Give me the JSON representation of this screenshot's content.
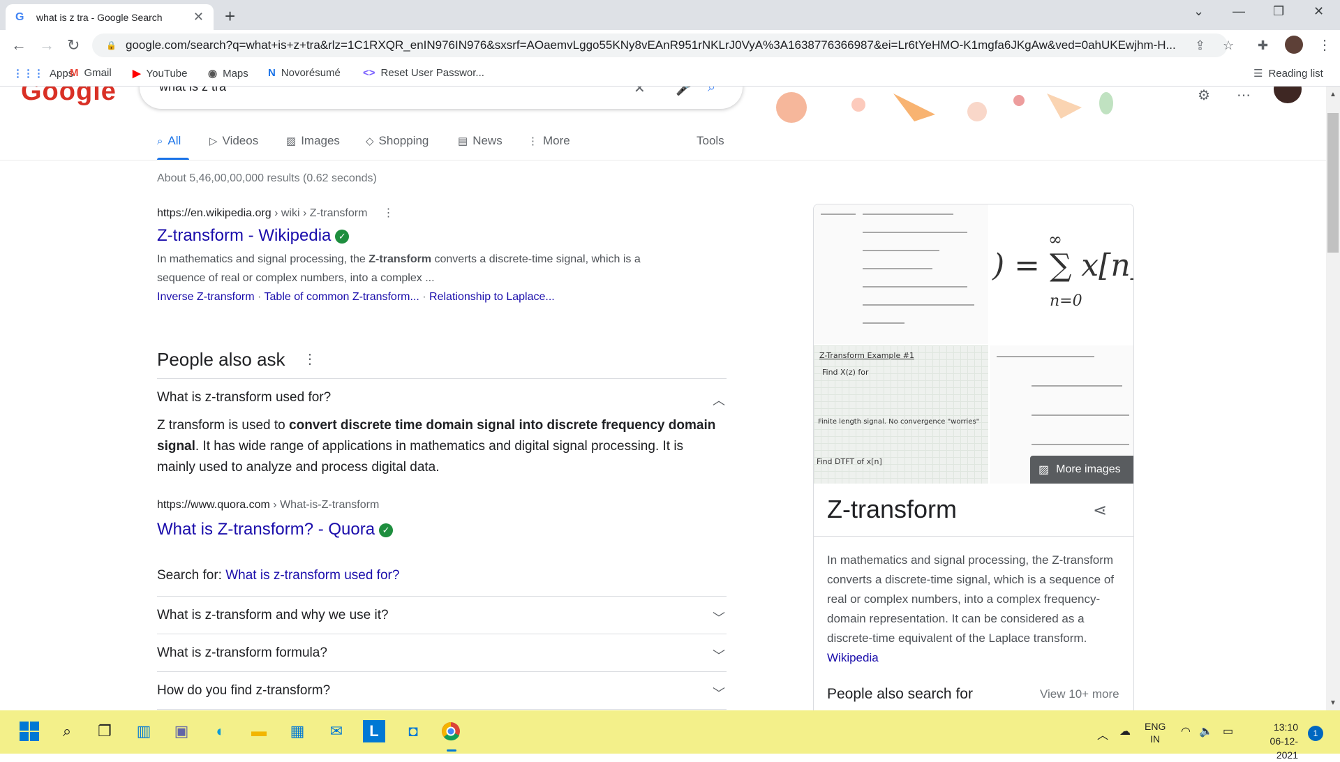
{
  "browser": {
    "tab_title": "what is z tra - Google Search",
    "url": "google.com/search?q=what+is+z+tra&rlz=1C1RXQR_enIN976IN976&sxsrf=AOaemvLggo55KNy8vEAnR951rNKLrJ0VyA%3A1638776366987&ei=Lr6tYeHMO-K1mgfa6JKgAw&ved=0ahUKEwjhm-H...",
    "bookmarks": [
      "Apps",
      "Gmail",
      "YouTube",
      "Maps",
      "Novorésumé",
      "Reset User Passwor..."
    ],
    "reading_list": "Reading list"
  },
  "search": {
    "query": "what is z tra",
    "tabs": [
      "All",
      "Videos",
      "Images",
      "Shopping",
      "News",
      "More"
    ],
    "tools": "Tools",
    "stats": "About 5,46,00,00,000 results (0.62 seconds)"
  },
  "results": [
    {
      "cite_domain": "https://en.wikipedia.org",
      "cite_path": " › wiki › Z-transform",
      "title": "Z-transform - Wikipedia",
      "snippet_pre": "In mathematics and signal processing, the ",
      "snippet_bold": "Z-transform",
      "snippet_post": " converts a discrete-time signal, which is a sequence of real or complex numbers, into a complex ...",
      "sitelinks": [
        "Inverse Z-transform",
        "Table of common Z-transform...",
        "Relationship to Laplace..."
      ]
    }
  ],
  "paa": {
    "title": "People also ask",
    "expanded_question": "What is z-transform used for?",
    "answer_pre": "Z transform is used to ",
    "answer_bold": "convert discrete time domain signal into discrete frequency domain signal",
    "answer_post": ". It has wide range of applications in mathematics and digital signal processing. It is mainly used to analyze and process digital data.",
    "source_domain": "https://www.quora.com",
    "source_path": " › What-is-Z-transform",
    "source_title": "What is Z-transform? - Quora",
    "search_for_label": "Search for: ",
    "search_for_link": "What is z-transform used for?",
    "questions": [
      "What is z-transform and why we use it?",
      "What is z-transform formula?",
      "How do you find z-transform?"
    ]
  },
  "knowledge_panel": {
    "title": "Z-transform",
    "more_images": "More images",
    "description": "In mathematics and signal processing, the Z-transform converts a discrete-time signal, which is a sequence of real or complex numbers, into a complex frequency-domain representation. It can be considered as a discrete-time equivalent of the Laplace transform.",
    "source_link": "Wikipedia",
    "pasf": "People also search for",
    "view_more": "View 10+ more",
    "img_formula": ") = ∑ x[n]",
    "img_formula_sub": "n=0",
    "img_formula_sup": "∞",
    "img_note_title": "Z-Transform Example #1",
    "img_note_find": "Find X(z) for",
    "img_note_finite": "Finite length signal. No convergence \"worries\"",
    "img_note_dtft": "Find DTFT of x[n]"
  },
  "taskbar": {
    "lang_top": "ENG",
    "lang_bottom": "IN",
    "time": "13:10",
    "date": "06-12-2021",
    "notifications": "1"
  }
}
